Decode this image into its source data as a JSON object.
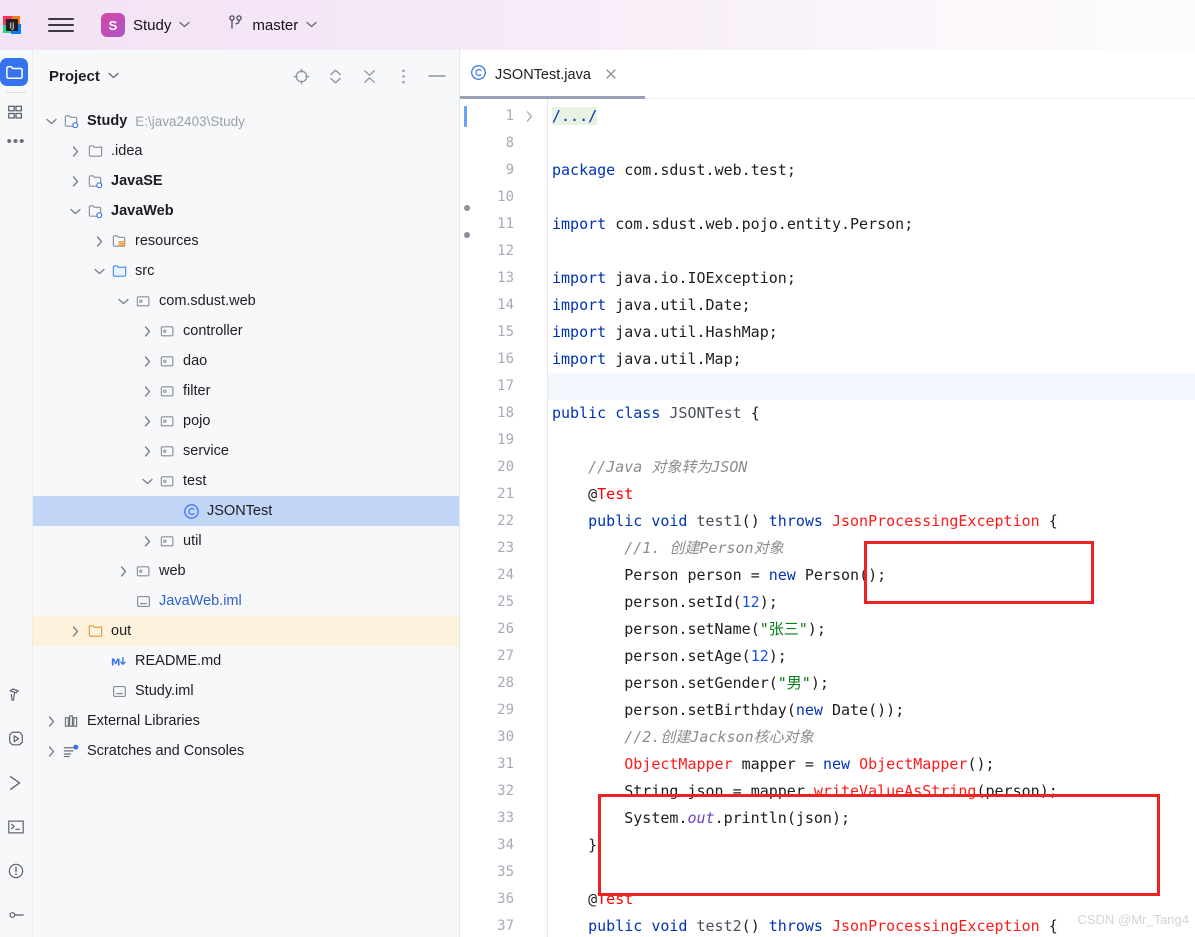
{
  "topbar": {
    "app_icon": "intellij-idea-logo",
    "menu_icon": "hamburger-menu-icon",
    "project_badge_letter": "S",
    "project_name": "Study",
    "project_chevron": "chevron-down-icon",
    "branch_icon": "git-branch-icon",
    "branch_name": "master",
    "branch_chevron": "chevron-down-icon",
    "accent_gradient_from": "#d946a6",
    "accent_gradient_to": "#a855c7"
  },
  "rail": {
    "top_items": [
      {
        "name": "project-tool-window",
        "icon": "folder-icon",
        "active": true
      },
      {
        "name": "structure-tool-window",
        "icon": "modules-icon",
        "active": false
      },
      {
        "name": "more-tool-windows",
        "icon": "ellipsis-icon",
        "active": false
      }
    ],
    "bottom_items": [
      {
        "name": "build-tool-window",
        "icon": "hammer-icon"
      },
      {
        "name": "run-tool-window",
        "icon": "play-icon"
      },
      {
        "name": "debug-tool-window",
        "icon": "chevron-right-icon"
      },
      {
        "name": "terminal-tool-window",
        "icon": "terminal-icon"
      },
      {
        "name": "problems-tool-window",
        "icon": "warning-circle-icon"
      },
      {
        "name": "version-control-tool-window",
        "icon": "commit-icon"
      }
    ]
  },
  "panel": {
    "title": "Project",
    "title_chevron": "chevron-down-icon",
    "tools": [
      {
        "name": "select-opened-file-button",
        "icon": "locate-target-icon"
      },
      {
        "name": "expand-collapse-button",
        "icon": "chevron-up-down-icon"
      },
      {
        "name": "collapse-all-button",
        "icon": "collapse-all-icon"
      },
      {
        "name": "options-button",
        "icon": "vertical-dots-icon"
      },
      {
        "name": "hide-panel-button",
        "icon": "minimize-icon"
      }
    ],
    "tree": [
      {
        "indent": 0,
        "arrow": "down",
        "icon": "module-icon",
        "label": "Study",
        "bold": true,
        "path": "E:\\java2403\\Study",
        "state": "normal"
      },
      {
        "indent": 1,
        "arrow": "right",
        "icon": "folder-icon",
        "label": ".idea",
        "bold": false,
        "state": "normal"
      },
      {
        "indent": 1,
        "arrow": "right",
        "icon": "module-icon",
        "label": "JavaSE",
        "bold": true,
        "state": "normal"
      },
      {
        "indent": 1,
        "arrow": "down",
        "icon": "module-icon",
        "label": "JavaWeb",
        "bold": true,
        "state": "normal"
      },
      {
        "indent": 2,
        "arrow": "right",
        "icon": "resources-icon",
        "label": "resources",
        "bold": false,
        "state": "normal"
      },
      {
        "indent": 2,
        "arrow": "down",
        "icon": "source-icon",
        "label": "src",
        "bold": false,
        "state": "normal"
      },
      {
        "indent": 3,
        "arrow": "down",
        "icon": "package-icon",
        "label": "com.sdust.web",
        "bold": false,
        "state": "normal"
      },
      {
        "indent": 4,
        "arrow": "right",
        "icon": "package-icon",
        "label": "controller",
        "bold": false,
        "state": "normal"
      },
      {
        "indent": 4,
        "arrow": "right",
        "icon": "package-icon",
        "label": "dao",
        "bold": false,
        "state": "normal"
      },
      {
        "indent": 4,
        "arrow": "right",
        "icon": "package-icon",
        "label": "filter",
        "bold": false,
        "state": "normal"
      },
      {
        "indent": 4,
        "arrow": "right",
        "icon": "package-icon",
        "label": "pojo",
        "bold": false,
        "state": "normal"
      },
      {
        "indent": 4,
        "arrow": "right",
        "icon": "package-icon",
        "label": "service",
        "bold": false,
        "state": "normal"
      },
      {
        "indent": 4,
        "arrow": "down",
        "icon": "package-icon",
        "label": "test",
        "bold": false,
        "state": "normal"
      },
      {
        "indent": 5,
        "arrow": "none",
        "icon": "java-class-icon",
        "label": "JSONTest",
        "bold": false,
        "state": "selected"
      },
      {
        "indent": 4,
        "arrow": "right",
        "icon": "package-icon",
        "label": "util",
        "bold": false,
        "state": "normal"
      },
      {
        "indent": 3,
        "arrow": "right",
        "icon": "package-icon",
        "label": "web",
        "bold": false,
        "state": "normal"
      },
      {
        "indent": 3,
        "arrow": "none",
        "icon": "iml-icon",
        "label": "JavaWeb.iml",
        "bold": false,
        "state": "link"
      },
      {
        "indent": 1,
        "arrow": "right",
        "icon": "out-folder-icon",
        "label": "out",
        "bold": false,
        "state": "excluded"
      },
      {
        "indent": 2,
        "arrow": "none",
        "icon": "markdown-icon",
        "label": "README.md",
        "bold": false,
        "state": "normal"
      },
      {
        "indent": 2,
        "arrow": "none",
        "icon": "iml-icon",
        "label": "Study.iml",
        "bold": false,
        "state": "normal"
      },
      {
        "indent": 0,
        "arrow": "right",
        "icon": "library-icon",
        "label": "External Libraries",
        "bold": false,
        "state": "normal"
      },
      {
        "indent": 0,
        "arrow": "right",
        "icon": "scratches-icon",
        "label": "Scratches and Consoles",
        "bold": false,
        "state": "normal"
      }
    ]
  },
  "editor": {
    "tab": {
      "icon": "java-class-icon",
      "label": "JSONTest.java",
      "close_icon": "close-icon"
    },
    "lines": [
      {
        "no": "1",
        "folded": true,
        "text": "/.../"
      },
      {
        "no": "8",
        "text": ""
      },
      {
        "no": "9",
        "text": "package com.sdust.web.test;"
      },
      {
        "no": "10",
        "text": ""
      },
      {
        "no": "11",
        "text": "import com.sdust.web.pojo.entity.Person;"
      },
      {
        "no": "12",
        "text": ""
      },
      {
        "no": "13",
        "text": "import java.io.IOException;"
      },
      {
        "no": "14",
        "text": "import java.util.Date;"
      },
      {
        "no": "15",
        "text": "import java.util.HashMap;"
      },
      {
        "no": "16",
        "text": "import java.util.Map;"
      },
      {
        "no": "17",
        "text": "",
        "highlight": true
      },
      {
        "no": "18",
        "text": "public class JSONTest {"
      },
      {
        "no": "19",
        "text": ""
      },
      {
        "no": "20",
        "text": "    //Java 对象转为JSON"
      },
      {
        "no": "21",
        "text": "    @Test"
      },
      {
        "no": "22",
        "text": "    public void test1() throws JsonProcessingException {"
      },
      {
        "no": "23",
        "text": "        //1. 创建Person对象"
      },
      {
        "no": "24",
        "text": "        Person person = new Person();"
      },
      {
        "no": "25",
        "text": "        person.setId(12);"
      },
      {
        "no": "26",
        "text": "        person.setName(\"张三\");"
      },
      {
        "no": "27",
        "text": "        person.setAge(12);"
      },
      {
        "no": "28",
        "text": "        person.setGender(\"男\");"
      },
      {
        "no": "29",
        "text": "        person.setBirthday(new Date());"
      },
      {
        "no": "30",
        "text": "        //2.创建Jackson核心对象"
      },
      {
        "no": "31",
        "text": "        ObjectMapper mapper = new ObjectMapper();"
      },
      {
        "no": "32",
        "text": "        String json = mapper.writeValueAsString(person);"
      },
      {
        "no": "33",
        "text": "        System.out.println(json);"
      },
      {
        "no": "34",
        "text": "    }"
      },
      {
        "no": "35",
        "text": ""
      },
      {
        "no": "36",
        "text": "    @Test"
      },
      {
        "no": "37",
        "text": "    public void test2() throws JsonProcessingException {"
      }
    ],
    "annotations": [
      {
        "name": "redbox-jsonprocessingexception",
        "color": "#ee2222"
      },
      {
        "name": "redbox-objectmapper-block",
        "color": "#ee2222"
      }
    ],
    "watermark": "CSDN @Mr_Tang4"
  }
}
